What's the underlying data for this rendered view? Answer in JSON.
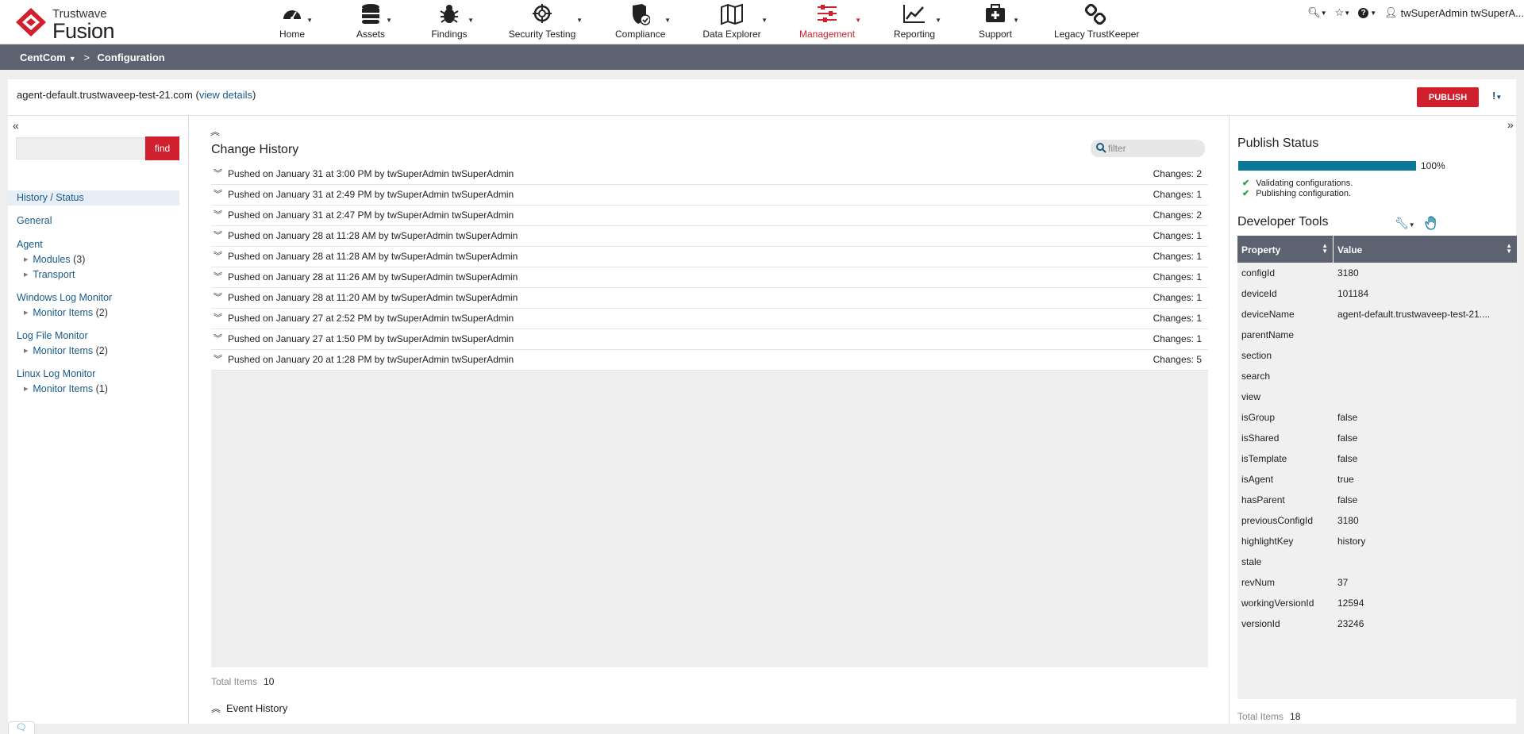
{
  "brand": {
    "line1": "Trustwave",
    "line2": "Fusion",
    "accent": "#d0202e"
  },
  "nav": [
    {
      "label": "Home",
      "icon": "dashboard-gauge-icon"
    },
    {
      "label": "Assets",
      "icon": "database-icon"
    },
    {
      "label": "Findings",
      "icon": "bug-icon"
    },
    {
      "label": "Security Testing",
      "icon": "crosshair-icon"
    },
    {
      "label": "Compliance",
      "icon": "shield-check-icon"
    },
    {
      "label": "Data Explorer",
      "icon": "map-icon"
    },
    {
      "label": "Management",
      "icon": "sliders-icon",
      "active": true
    },
    {
      "label": "Reporting",
      "icon": "line-chart-icon"
    },
    {
      "label": "Support",
      "icon": "first-aid-kit-icon"
    },
    {
      "label": "Legacy TrustKeeper",
      "icon": "chain-link-icon"
    }
  ],
  "user": {
    "name": "twSuperAdmin twSuperA..."
  },
  "breadcrumb": {
    "root": "CentCom",
    "sep": ">",
    "current": "Configuration"
  },
  "device": {
    "name": "agent-default.trustwaveep-test-21.com",
    "link_open": "(",
    "link": "view details",
    "link_close": ")"
  },
  "toolbar": {
    "publish_label": "PUBLISH",
    "alert_label": "!"
  },
  "search": {
    "find_label": "find",
    "value": ""
  },
  "tree": {
    "history": "History / Status",
    "general": "General",
    "agent": "Agent",
    "agent_children": [
      {
        "label": "Modules",
        "count": "(3)"
      },
      {
        "label": "Transport",
        "count": ""
      }
    ],
    "winlog": "Windows Log Monitor",
    "winlog_children": [
      {
        "label": "Monitor Items",
        "count": "(2)"
      }
    ],
    "filelog": "Log File Monitor",
    "filelog_children": [
      {
        "label": "Monitor Items",
        "count": "(2)"
      }
    ],
    "linuxlog": "Linux Log Monitor",
    "linuxlog_children": [
      {
        "label": "Monitor Items",
        "count": "(1)"
      }
    ]
  },
  "change_history": {
    "title": "Change History",
    "filter_placeholder": "filter",
    "rows": [
      {
        "text": "Pushed on January 31 at 3:00 PM by twSuperAdmin twSuperAdmin",
        "changes": "Changes: 2"
      },
      {
        "text": "Pushed on January 31 at 2:49 PM by twSuperAdmin twSuperAdmin",
        "changes": "Changes: 1"
      },
      {
        "text": "Pushed on January 31 at 2:47 PM by twSuperAdmin twSuperAdmin",
        "changes": "Changes: 2"
      },
      {
        "text": "Pushed on January 28 at 11:28 AM by twSuperAdmin twSuperAdmin",
        "changes": "Changes: 1"
      },
      {
        "text": "Pushed on January 28 at 11:28 AM by twSuperAdmin twSuperAdmin",
        "changes": "Changes: 1"
      },
      {
        "text": "Pushed on January 28 at 11:26 AM by twSuperAdmin twSuperAdmin",
        "changes": "Changes: 1"
      },
      {
        "text": "Pushed on January 28 at 11:20 AM by twSuperAdmin twSuperAdmin",
        "changes": "Changes: 1"
      },
      {
        "text": "Pushed on January 27 at 2:52 PM by twSuperAdmin twSuperAdmin",
        "changes": "Changes: 1"
      },
      {
        "text": "Pushed on January 27 at 1:50 PM by twSuperAdmin twSuperAdmin",
        "changes": "Changes: 1"
      },
      {
        "text": "Pushed on January 20 at 1:28 PM by twSuperAdmin twSuperAdmin",
        "changes": "Changes: 5"
      }
    ],
    "total_label": "Total Items",
    "total_value": "10"
  },
  "event_history": {
    "label": "Event History"
  },
  "publish_status": {
    "title": "Publish Status",
    "progress": 1.0,
    "percent_label": "100%",
    "steps": [
      "Validating configurations.",
      "Publishing configuration."
    ]
  },
  "dev_tools": {
    "title": "Developer Tools",
    "col_property": "Property",
    "col_value": "Value",
    "rows": [
      {
        "k": "configId",
        "v": "3180"
      },
      {
        "k": "deviceId",
        "v": "101184"
      },
      {
        "k": "deviceName",
        "v": "agent-default.trustwaveep-test-21...."
      },
      {
        "k": "parentName",
        "v": ""
      },
      {
        "k": "section",
        "v": ""
      },
      {
        "k": "search",
        "v": ""
      },
      {
        "k": "view",
        "v": ""
      },
      {
        "k": "isGroup",
        "v": "false"
      },
      {
        "k": "isShared",
        "v": "false"
      },
      {
        "k": "isTemplate",
        "v": "false"
      },
      {
        "k": "isAgent",
        "v": "true"
      },
      {
        "k": "hasParent",
        "v": "false"
      },
      {
        "k": "previousConfigId",
        "v": "3180"
      },
      {
        "k": "highlightKey",
        "v": "history"
      },
      {
        "k": "stale",
        "v": ""
      },
      {
        "k": "revNum",
        "v": "37"
      },
      {
        "k": "workingVersionId",
        "v": "12594"
      },
      {
        "k": "versionId",
        "v": "23246"
      }
    ],
    "total_label": "Total Items",
    "total_value": "18"
  }
}
